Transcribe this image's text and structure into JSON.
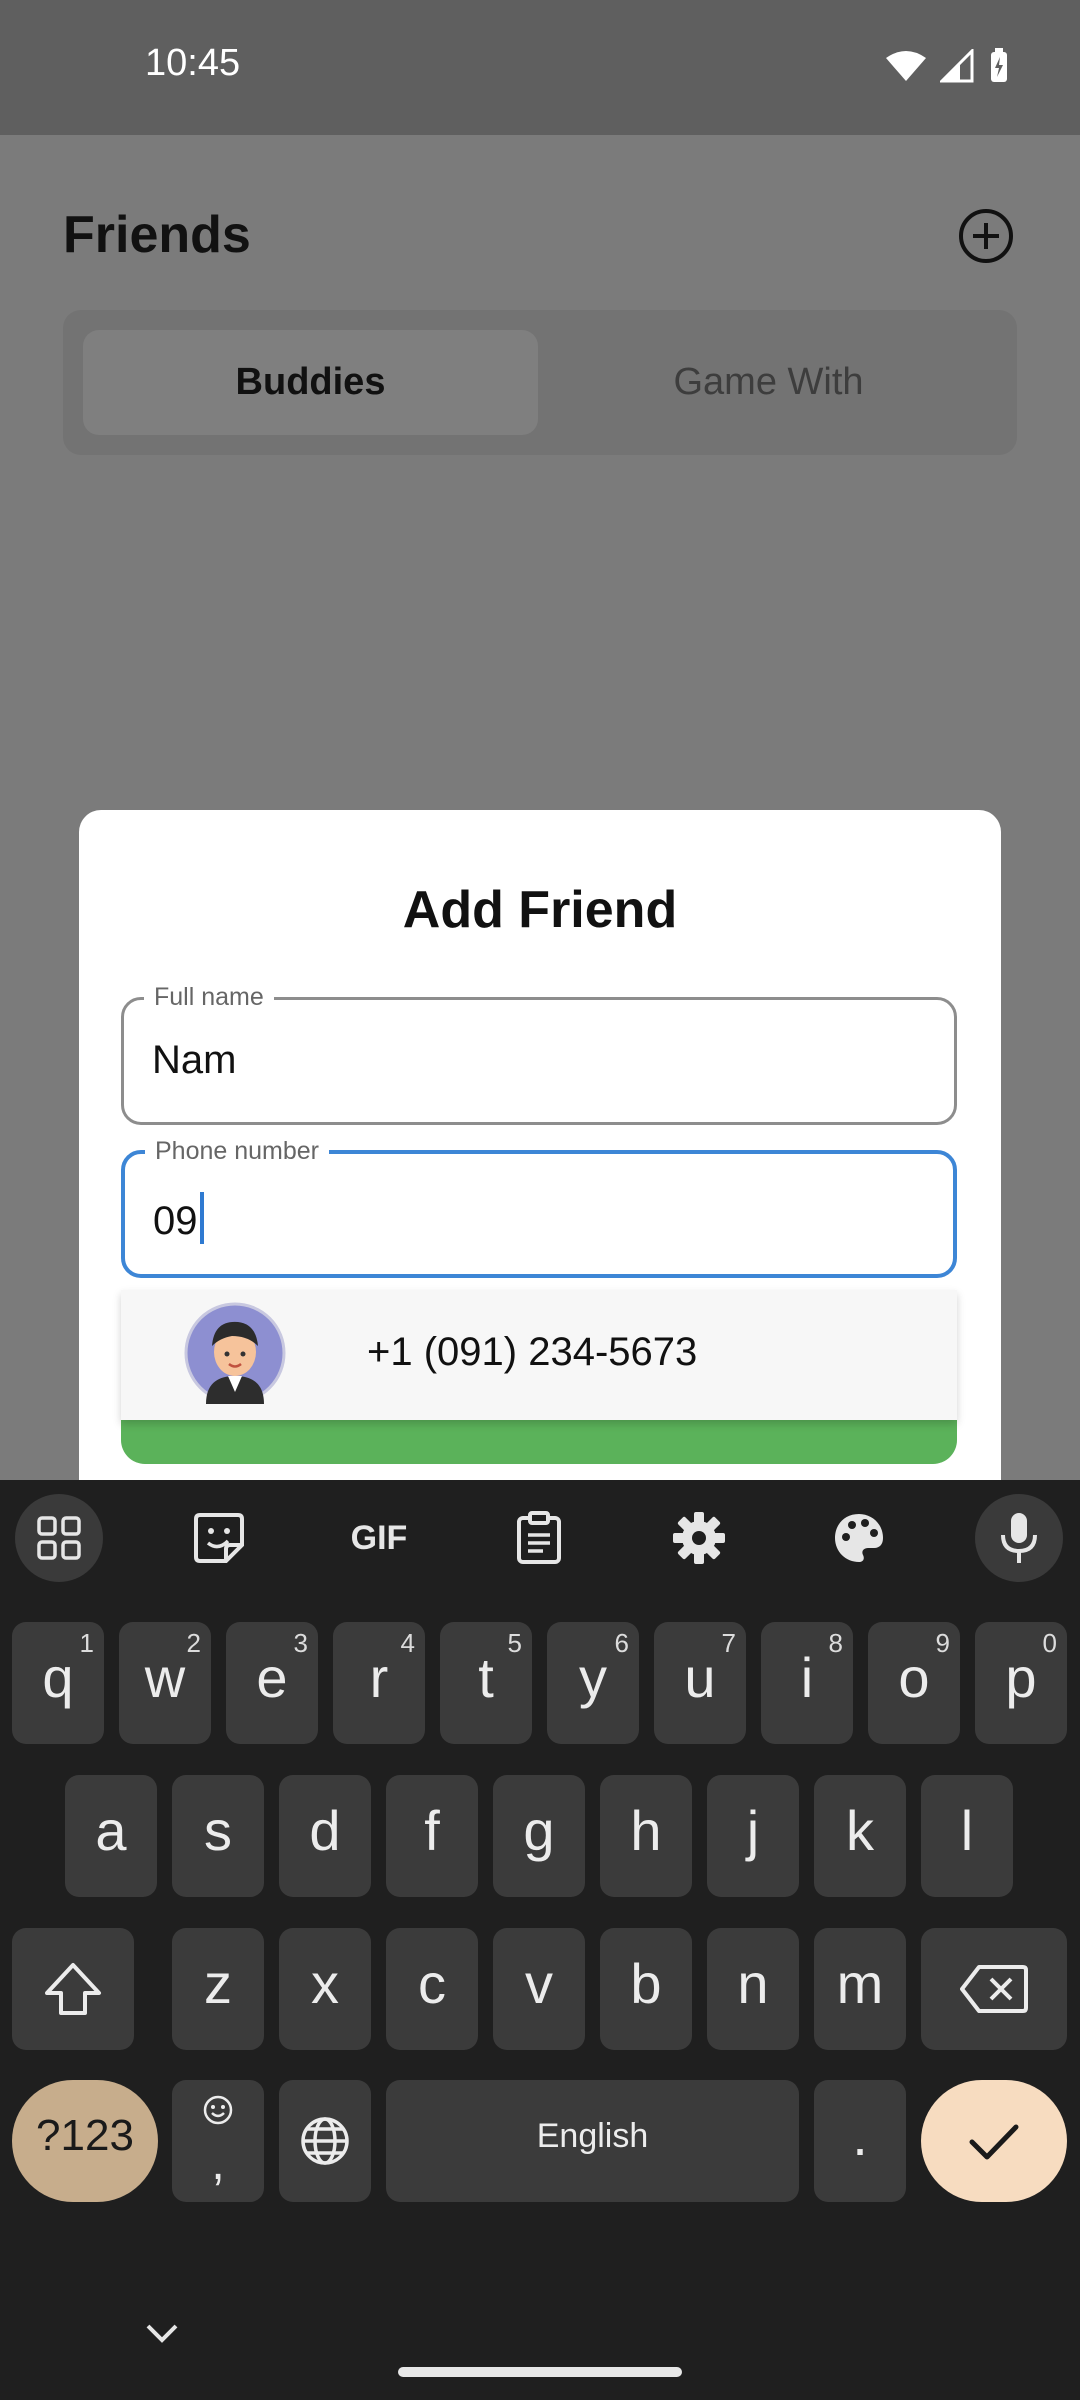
{
  "status": {
    "time": "10:45"
  },
  "app": {
    "title": "Friends",
    "tabs": [
      {
        "label": "Buddies",
        "active": true
      },
      {
        "label": "Game With",
        "active": false
      }
    ]
  },
  "dialog": {
    "title": "Add Friend",
    "full_name": {
      "label": "Full name",
      "value": "Nam"
    },
    "phone": {
      "label": "Phone number",
      "value": "09"
    },
    "suggestion": {
      "phone": "+1 (091) 234-5673"
    },
    "button_color": "#5bb25a"
  },
  "keyboard": {
    "toolbar": [
      "apps-icon",
      "sticker-icon",
      "gif-icon",
      "clipboard-icon",
      "settings-icon",
      "palette-icon",
      "mic-icon"
    ],
    "gif_label": "GIF",
    "row1": [
      {
        "k": "q",
        "h": "1"
      },
      {
        "k": "w",
        "h": "2"
      },
      {
        "k": "e",
        "h": "3"
      },
      {
        "k": "r",
        "h": "4"
      },
      {
        "k": "t",
        "h": "5"
      },
      {
        "k": "y",
        "h": "6"
      },
      {
        "k": "u",
        "h": "7"
      },
      {
        "k": "i",
        "h": "8"
      },
      {
        "k": "o",
        "h": "9"
      },
      {
        "k": "p",
        "h": "0"
      }
    ],
    "row2": [
      "a",
      "s",
      "d",
      "f",
      "g",
      "h",
      "j",
      "k",
      "l"
    ],
    "row3": [
      "z",
      "x",
      "c",
      "v",
      "b",
      "n",
      "m"
    ],
    "symbols_label": "?123",
    "comma_label": ",",
    "space_label": "English",
    "period_label": "."
  }
}
